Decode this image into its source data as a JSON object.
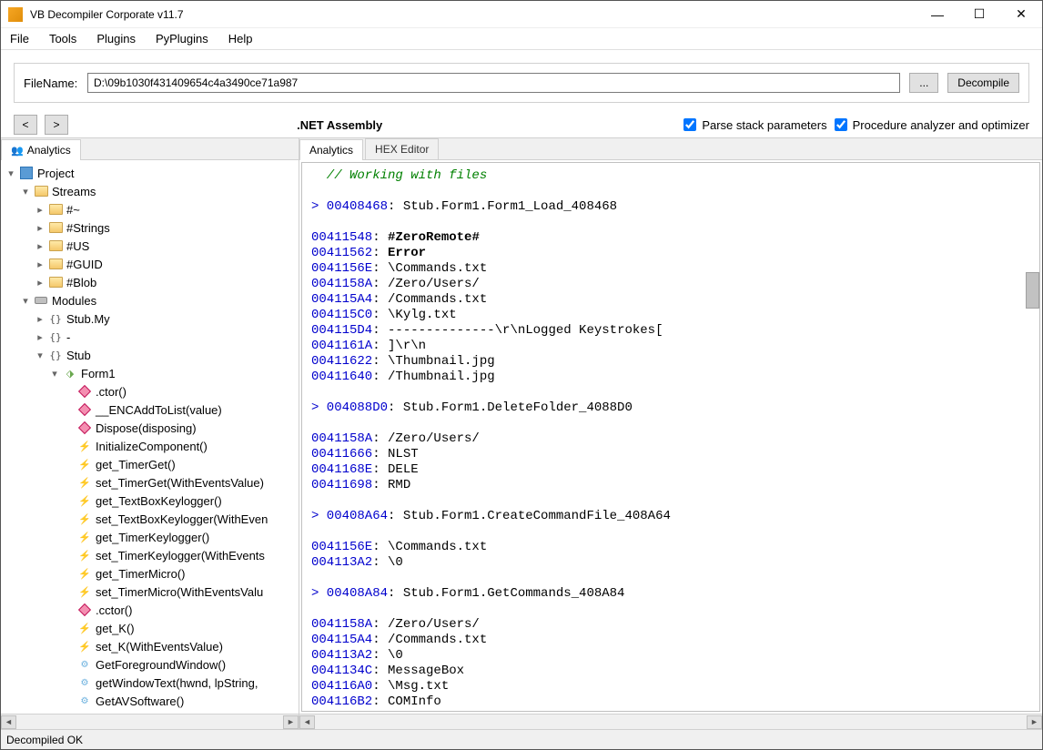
{
  "window": {
    "title": "VB Decompiler Corporate v11.7"
  },
  "menu": {
    "file": "File",
    "tools": "Tools",
    "plugins": "Plugins",
    "pyplugins": "PyPlugins",
    "help": "Help"
  },
  "toolbar": {
    "filenameLabel": "FileName:",
    "filenameValue": "D:\\09b1030f431409654c4a3490ce71a987",
    "browse": "...",
    "decompile": "Decompile"
  },
  "nav": {
    "back": "<",
    "forward": ">",
    "assembly": ".NET Assembly",
    "chkStack": "Parse stack parameters",
    "chkProc": "Procedure analyzer and optimizer"
  },
  "leftTabs": {
    "analytics": "Analytics"
  },
  "rightTabs": {
    "analytics": "Analytics",
    "hex": "HEX Editor"
  },
  "tree": {
    "project": "Project",
    "streams": "Streams",
    "s_hash": "#~",
    "s_strings": "#Strings",
    "s_us": "#US",
    "s_guid": "#GUID",
    "s_blob": "#Blob",
    "modules": "Modules",
    "m_stubmy": "Stub.My",
    "m_dash": "-",
    "m_stub": "Stub",
    "form1": "Form1",
    "methods": [
      ".ctor()",
      "__ENCAddToList(value)",
      "Dispose(disposing)",
      "InitializeComponent()",
      "get_TimerGet()",
      "set_TimerGet(WithEventsValue)",
      "get_TextBoxKeylogger()",
      "set_TextBoxKeylogger(WithEven",
      "get_TimerKeylogger()",
      "set_TimerKeylogger(WithEvents",
      "get_TimerMicro()",
      "set_TimerMicro(WithEventsValu",
      ".cctor()",
      "get_K()",
      "set_K(WithEventsValue)",
      "GetForegroundWindow()",
      "getWindowText(hwnd, lpString,",
      "GetAVSoftware()"
    ],
    "methodIcons": [
      "m",
      "m",
      "m",
      "l",
      "l",
      "l",
      "l",
      "l",
      "l",
      "l",
      "l",
      "l",
      "m",
      "l",
      "l",
      "g",
      "g",
      "g"
    ]
  },
  "code": [
    {
      "t": "comment",
      "s": "  // Working with files"
    },
    {
      "t": "blank"
    },
    {
      "t": "call",
      "addr": "> 00408468",
      "s": ": Stub.Form1.Form1_Load_408468"
    },
    {
      "t": "blank"
    },
    {
      "t": "str",
      "addr": "00411548",
      "s": ": ",
      "b": "#ZeroRemote#"
    },
    {
      "t": "str",
      "addr": "00411562",
      "s": ": ",
      "b": "Error"
    },
    {
      "t": "str",
      "addr": "0041156E",
      "s": ": \\Commands.txt"
    },
    {
      "t": "str",
      "addr": "0041158A",
      "s": ": /Zero/Users/"
    },
    {
      "t": "str",
      "addr": "004115A4",
      "s": ": /Commands.txt"
    },
    {
      "t": "str",
      "addr": "004115C0",
      "s": ": \\Kylg.txt"
    },
    {
      "t": "str",
      "addr": "004115D4",
      "s": ": --------------\\r\\nLogged Keystrokes["
    },
    {
      "t": "str",
      "addr": "0041161A",
      "s": ": ]\\r\\n"
    },
    {
      "t": "str",
      "addr": "00411622",
      "s": ": \\Thumbnail.jpg"
    },
    {
      "t": "str",
      "addr": "00411640",
      "s": ": /Thumbnail.jpg"
    },
    {
      "t": "blank"
    },
    {
      "t": "call",
      "addr": "> 004088D0",
      "s": ": Stub.Form1.DeleteFolder_4088D0"
    },
    {
      "t": "blank"
    },
    {
      "t": "str",
      "addr": "0041158A",
      "s": ": /Zero/Users/"
    },
    {
      "t": "str",
      "addr": "00411666",
      "s": ": NLST"
    },
    {
      "t": "str",
      "addr": "0041168E",
      "s": ": DELE"
    },
    {
      "t": "str",
      "addr": "00411698",
      "s": ": RMD"
    },
    {
      "t": "blank"
    },
    {
      "t": "call",
      "addr": "> 00408A64",
      "s": ": Stub.Form1.CreateCommandFile_408A64"
    },
    {
      "t": "blank"
    },
    {
      "t": "str",
      "addr": "0041156E",
      "s": ": \\Commands.txt"
    },
    {
      "t": "str",
      "addr": "004113A2",
      "s": ": \\0"
    },
    {
      "t": "blank"
    },
    {
      "t": "call",
      "addr": "> 00408A84",
      "s": ": Stub.Form1.GetCommands_408A84"
    },
    {
      "t": "blank"
    },
    {
      "t": "str",
      "addr": "0041158A",
      "s": ": /Zero/Users/"
    },
    {
      "t": "str",
      "addr": "004115A4",
      "s": ": /Commands.txt"
    },
    {
      "t": "str",
      "addr": "004113A2",
      "s": ": \\0"
    },
    {
      "t": "str",
      "addr": "0041134C",
      "s": ": MessageBox"
    },
    {
      "t": "str",
      "addr": "004116A0",
      "s": ": \\Msg.txt"
    },
    {
      "t": "str",
      "addr": "004116B2",
      "s": ": COMInfo"
    }
  ],
  "status": "Decompiled OK"
}
